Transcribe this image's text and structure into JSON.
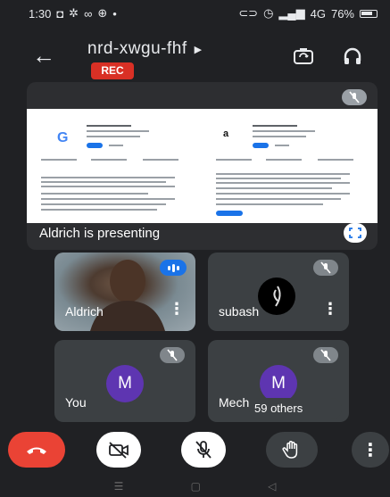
{
  "status_bar": {
    "time": "1:30",
    "left_icons": [
      "cast-icon",
      "settings-icon",
      "infinity-icon",
      "game-icon",
      "dot-icon"
    ],
    "right_text": "76%",
    "network": "4G"
  },
  "header": {
    "meeting_code": "nrd-xwgu-fhf",
    "rec_label": "REC"
  },
  "presentation": {
    "caption": "Aldrich is presenting"
  },
  "participants": [
    {
      "name": "Aldrich",
      "speaking": true
    },
    {
      "name": "subash",
      "muted": true
    },
    {
      "name": "You",
      "initial": "M",
      "muted": true
    },
    {
      "name": "Mech",
      "initial": "M",
      "muted": true
    }
  ],
  "others": "59 others",
  "controls": {
    "end_call": "end-call",
    "camera": "camera-off",
    "mic": "mic-off",
    "raise_hand": "raise-hand",
    "more": "more-options"
  },
  "colors": {
    "background": "#202124",
    "accent_red": "#ea4335",
    "rec_red": "#d93025",
    "avatar_purple": "#5e35b1",
    "speaking_blue": "#1a73e8"
  }
}
